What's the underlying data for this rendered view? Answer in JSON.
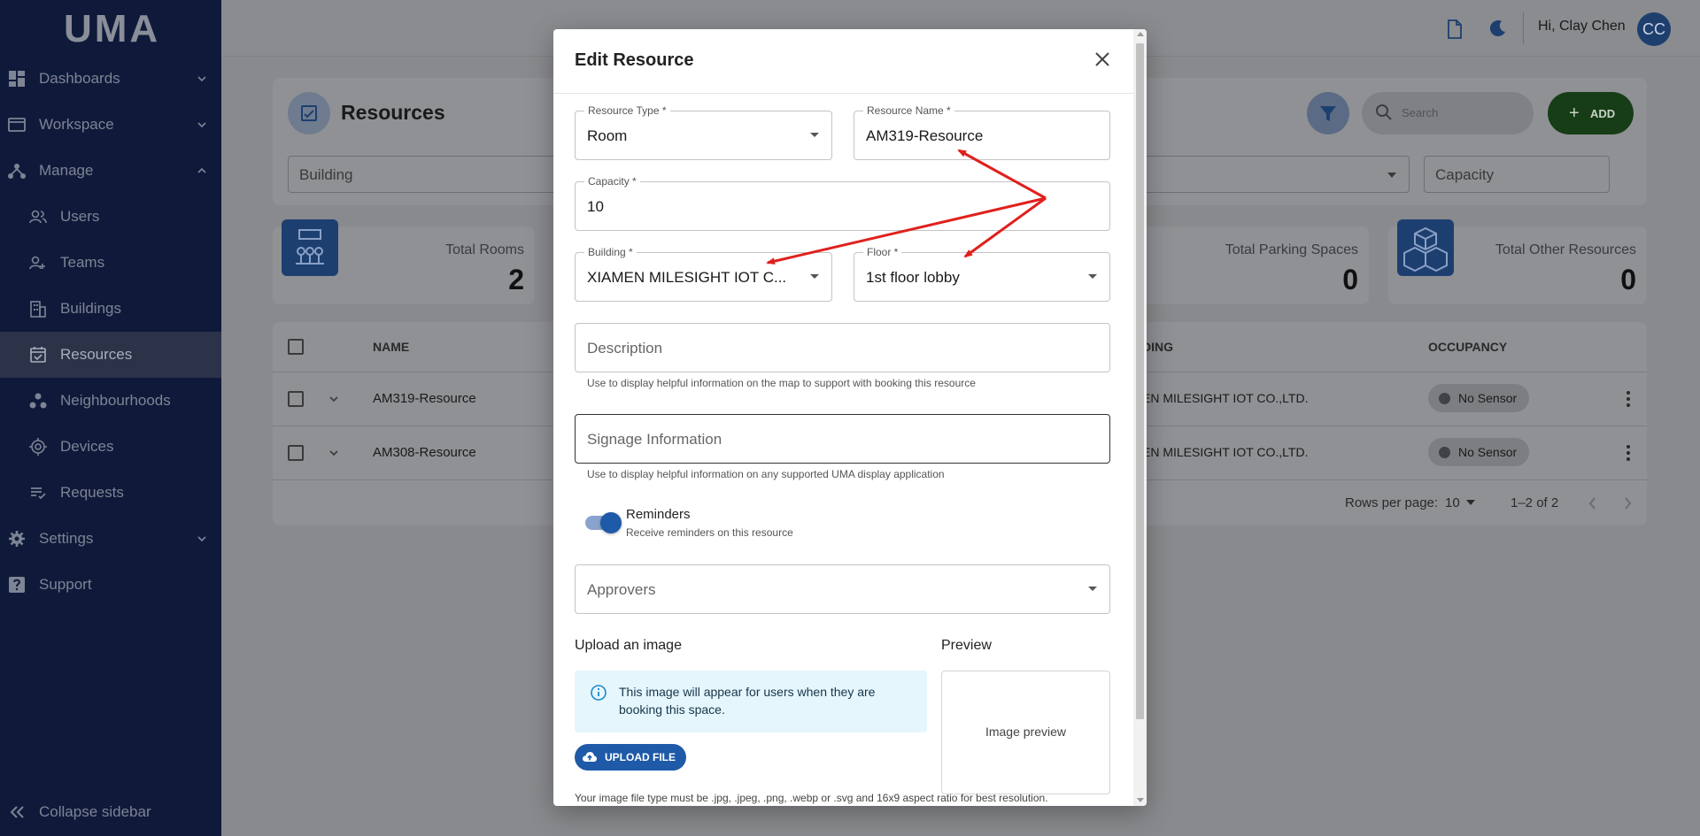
{
  "app": {
    "logo": "UMA"
  },
  "sidebar": {
    "items": [
      {
        "label": "Dashboards"
      },
      {
        "label": "Workspace"
      },
      {
        "label": "Manage"
      },
      {
        "label": "Users"
      },
      {
        "label": "Teams"
      },
      {
        "label": "Buildings"
      },
      {
        "label": "Resources"
      },
      {
        "label": "Neighbourhoods"
      },
      {
        "label": "Devices"
      },
      {
        "label": "Requests"
      },
      {
        "label": "Settings"
      },
      {
        "label": "Support"
      }
    ],
    "collapse_label": "Collapse sidebar"
  },
  "header": {
    "greeting": "Hi, Clay Chen",
    "avatar_initials": "CC"
  },
  "page": {
    "title": "Resources",
    "search_placeholder": "Search",
    "add_label": "ADD",
    "filters": {
      "building": "Building",
      "capacity": "Capacity"
    },
    "stats": [
      {
        "label": "Total Rooms",
        "value": "2"
      },
      {
        "label": "Total Parking Spaces",
        "value": "0"
      },
      {
        "label": "Total Other Resources",
        "value": "0"
      }
    ],
    "table": {
      "headers": {
        "name": "NAME",
        "building": "DING",
        "occupancy": "OCCUPANCY"
      },
      "rows": [
        {
          "name": "AM319-Resource",
          "building": "EN MILESIGHT IOT CO.,LTD.",
          "occupancy": "No Sensor"
        },
        {
          "name": "AM308-Resource",
          "building": "EN MILESIGHT IOT CO.,LTD.",
          "occupancy": "No Sensor"
        }
      ],
      "rows_per_page_label": "Rows per page:",
      "rows_per_page": "10",
      "range": "1–2 of 2"
    }
  },
  "modal": {
    "title": "Edit Resource",
    "fields": {
      "resource_type": {
        "label": "Resource Type *",
        "value": "Room"
      },
      "resource_name": {
        "label": "Resource Name *",
        "value": "AM319-Resource"
      },
      "capacity": {
        "label": "Capacity *",
        "value": "10"
      },
      "building": {
        "label": "Building *",
        "value": "XIAMEN MILESIGHT IOT C..."
      },
      "floor": {
        "label": "Floor *",
        "value": "1st floor lobby"
      },
      "description": {
        "placeholder": "Description",
        "helper": "Use to display helpful information on the map to support with booking this resource"
      },
      "signage": {
        "placeholder": "Signage Information",
        "helper": "Use to display helpful information on any supported UMA display application"
      },
      "approvers": {
        "placeholder": "Approvers"
      }
    },
    "reminders": {
      "label": "Reminders",
      "sub": "Receive reminders on this resource",
      "enabled": true
    },
    "upload": {
      "heading": "Upload an image",
      "info": "This image will appear for users when they are booking this space.",
      "button": "UPLOAD FILE",
      "hint": "Your image file type must be .jpg, .jpeg, .png, .webp or .svg and 16x9 aspect ratio for best resolution."
    },
    "preview": {
      "heading": "Preview",
      "placeholder": "Image preview"
    }
  },
  "colors": {
    "sidebar_bg": "#0f1a3b",
    "accent": "#1e5aa8",
    "add_button": "#173d16",
    "annotation": "#e0201c"
  }
}
